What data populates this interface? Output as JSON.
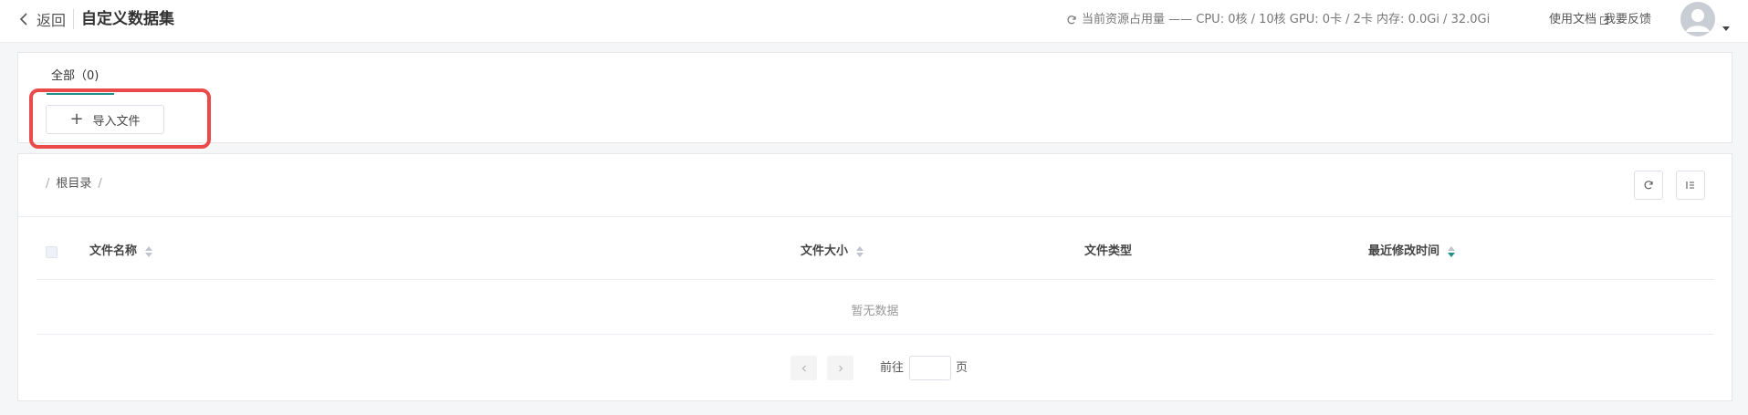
{
  "header": {
    "back_label": "返回",
    "title": "自定义数据集",
    "resource_usage": "当前资源占用量 —— CPU: 0核 / 10核 GPU: 0卡 / 2卡 内存: 0.0Gi / 32.0Gi",
    "docs_label": "使用文档",
    "feedback_label": "我要反馈",
    "icons": [
      "chevron-left-icon",
      "refresh-icon",
      "external-link-icon",
      "user-avatar-icon",
      "caret-down-icon"
    ]
  },
  "tabs": [
    {
      "label": "全部（0)",
      "active": true
    }
  ],
  "import_button": {
    "label": "导入文件",
    "icon": "plus-icon"
  },
  "highlight_color": "#ea4a4a",
  "breadcrumb": {
    "root": "根目录",
    "separator": "/"
  },
  "table": {
    "columns": [
      {
        "label": "文件名称",
        "sortable": true,
        "active": false
      },
      {
        "label": "文件大小",
        "sortable": true,
        "active": false
      },
      {
        "label": "文件类型",
        "sortable": false,
        "active": false
      },
      {
        "label": "最近修改时间",
        "sortable": true,
        "active": true
      }
    ],
    "rows": [],
    "empty_text": "暂无数据"
  },
  "pagination": {
    "goto_label": "前往",
    "page_suffix": "页",
    "input_value": ""
  },
  "colors": {
    "accent": "#1f8f8a",
    "highlight": "#ea4a4a"
  }
}
